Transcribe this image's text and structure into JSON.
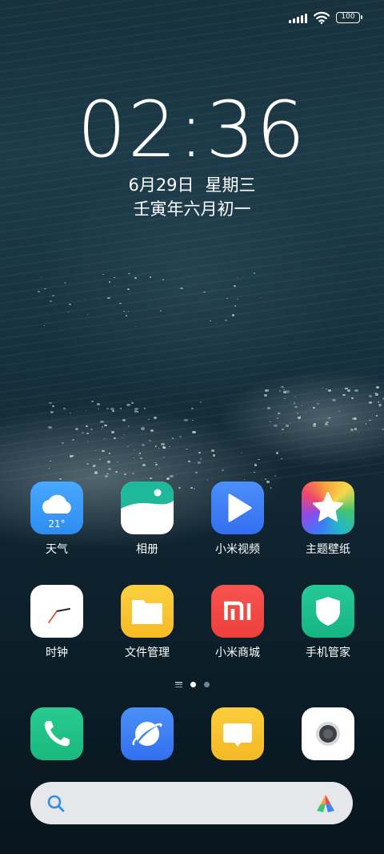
{
  "status_bar": {
    "battery": "100"
  },
  "lock": {
    "time": "02:36",
    "date": "6月29日",
    "weekday": "星期三",
    "lunar": "壬寅年六月初一"
  },
  "apps": [
    {
      "label": "天气",
      "icon": "weather-icon",
      "badge": "21°",
      "color": "#3d9cf5"
    },
    {
      "label": "相册",
      "icon": "gallery-icon",
      "color": "#21b89a"
    },
    {
      "label": "小米视频",
      "icon": "video-icon",
      "color": "#3f82f7"
    },
    {
      "label": "主题壁纸",
      "icon": "themes-icon",
      "color": "#f25d6a"
    },
    {
      "label": "时钟",
      "icon": "clock-icon",
      "color": "#ffffff"
    },
    {
      "label": "文件管理",
      "icon": "folder-icon",
      "color": "#f8c533"
    },
    {
      "label": "小米商城",
      "icon": "mi-store-icon",
      "badge": "mi",
      "color": "#f44a47"
    },
    {
      "label": "手机管家",
      "icon": "security-shield-icon",
      "color": "#1fc08f"
    }
  ],
  "dock": [
    {
      "name": "phone-icon",
      "color": "#22c48a"
    },
    {
      "name": "browser-icon",
      "color": "#3b86f5"
    },
    {
      "name": "messages-icon",
      "color": "#f8c234"
    },
    {
      "name": "camera-icon",
      "color": "#ffffff"
    }
  ],
  "pager": {
    "pages": 2,
    "active": 0
  },
  "search": {
    "placeholder": ""
  }
}
